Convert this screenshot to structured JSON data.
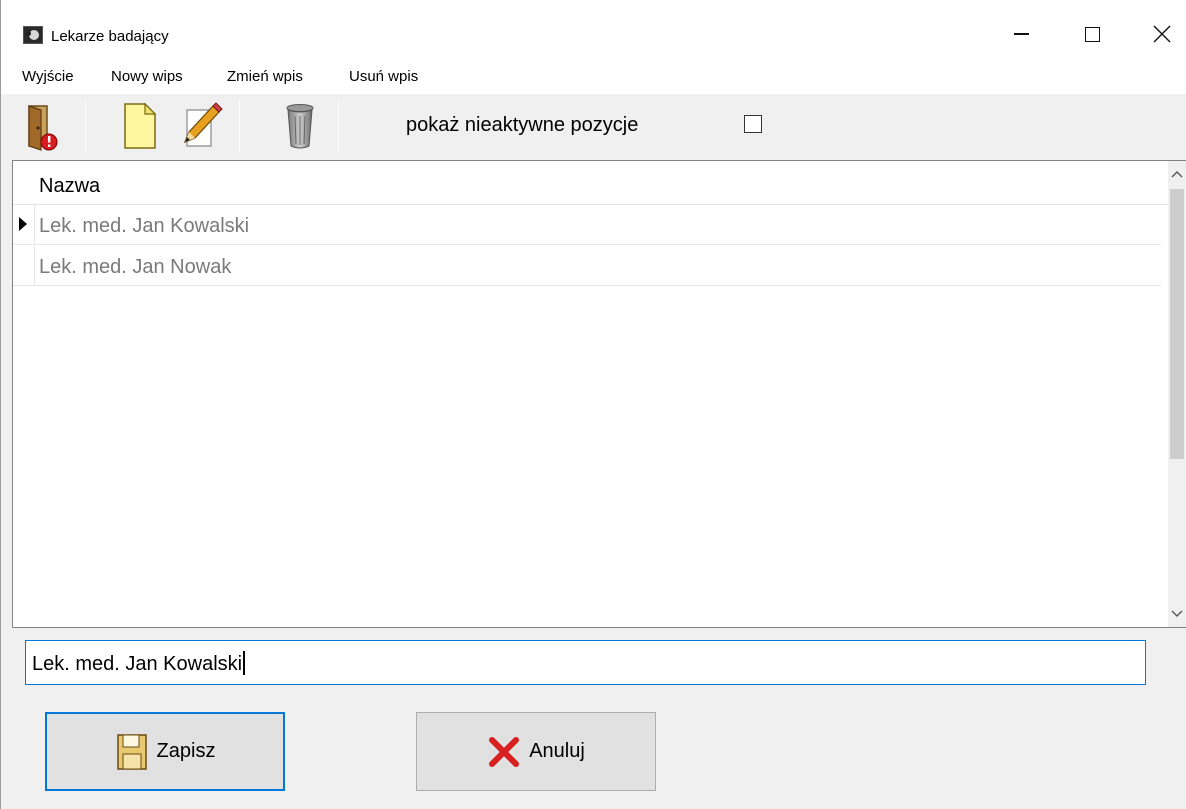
{
  "window": {
    "title": "Lekarze badający"
  },
  "menu": {
    "items": [
      "Wyjście",
      "Nowy wips",
      "Zmień wpis",
      "Usuń wpis"
    ]
  },
  "toolbar": {
    "buttons": [
      {
        "name": "exit",
        "icon": "door-exit-icon"
      },
      {
        "name": "new",
        "icon": "new-document-icon"
      },
      {
        "name": "edit",
        "icon": "pencil-edit-icon"
      },
      {
        "name": "delete",
        "icon": "trash-can-icon"
      }
    ],
    "inactive_label": "pokaż nieaktywne pozycje",
    "inactive_checked": false
  },
  "grid": {
    "column_header": "Nazwa",
    "rows": [
      {
        "name": "Lek. med. Jan Kowalski",
        "current": true
      },
      {
        "name": "Lek. med. Jan Nowak",
        "current": false
      }
    ]
  },
  "editor": {
    "value": "Lek. med. Jan Kowalski"
  },
  "actions": {
    "save_label": "Zapisz",
    "cancel_label": "Anuluj"
  },
  "colors": {
    "focus_blue": "#0078d7",
    "inactive_text": "#7a7a7a"
  }
}
